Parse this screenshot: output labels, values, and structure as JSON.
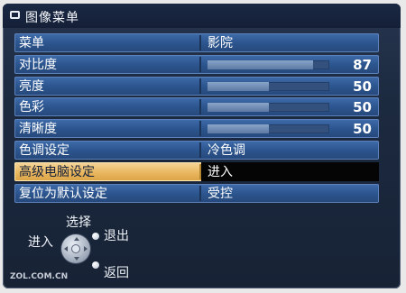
{
  "title": "图像菜单",
  "menu": {
    "rows": [
      {
        "label": "菜单",
        "value": "影院"
      },
      {
        "label": "对比度",
        "level": 87,
        "display": "87"
      },
      {
        "label": "亮度",
        "level": 50,
        "display": "50"
      },
      {
        "label": "色彩",
        "level": 50,
        "display": "50"
      },
      {
        "label": "清晰度",
        "level": 50,
        "display": "50"
      },
      {
        "label": "色调设定",
        "value": "冷色调"
      },
      {
        "label": "高级电脑设定",
        "value": "进入"
      },
      {
        "label": "复位为默认设定",
        "value": "受控"
      }
    ]
  },
  "nav": {
    "select": "选择",
    "enter": "进入",
    "exit": "退出",
    "back": "返回"
  },
  "watermark": "ZOL.COM.CN",
  "colors": {
    "row_blue": "#3f6cab",
    "selected_gold": "#e9b760",
    "background": "#1c2a40"
  }
}
